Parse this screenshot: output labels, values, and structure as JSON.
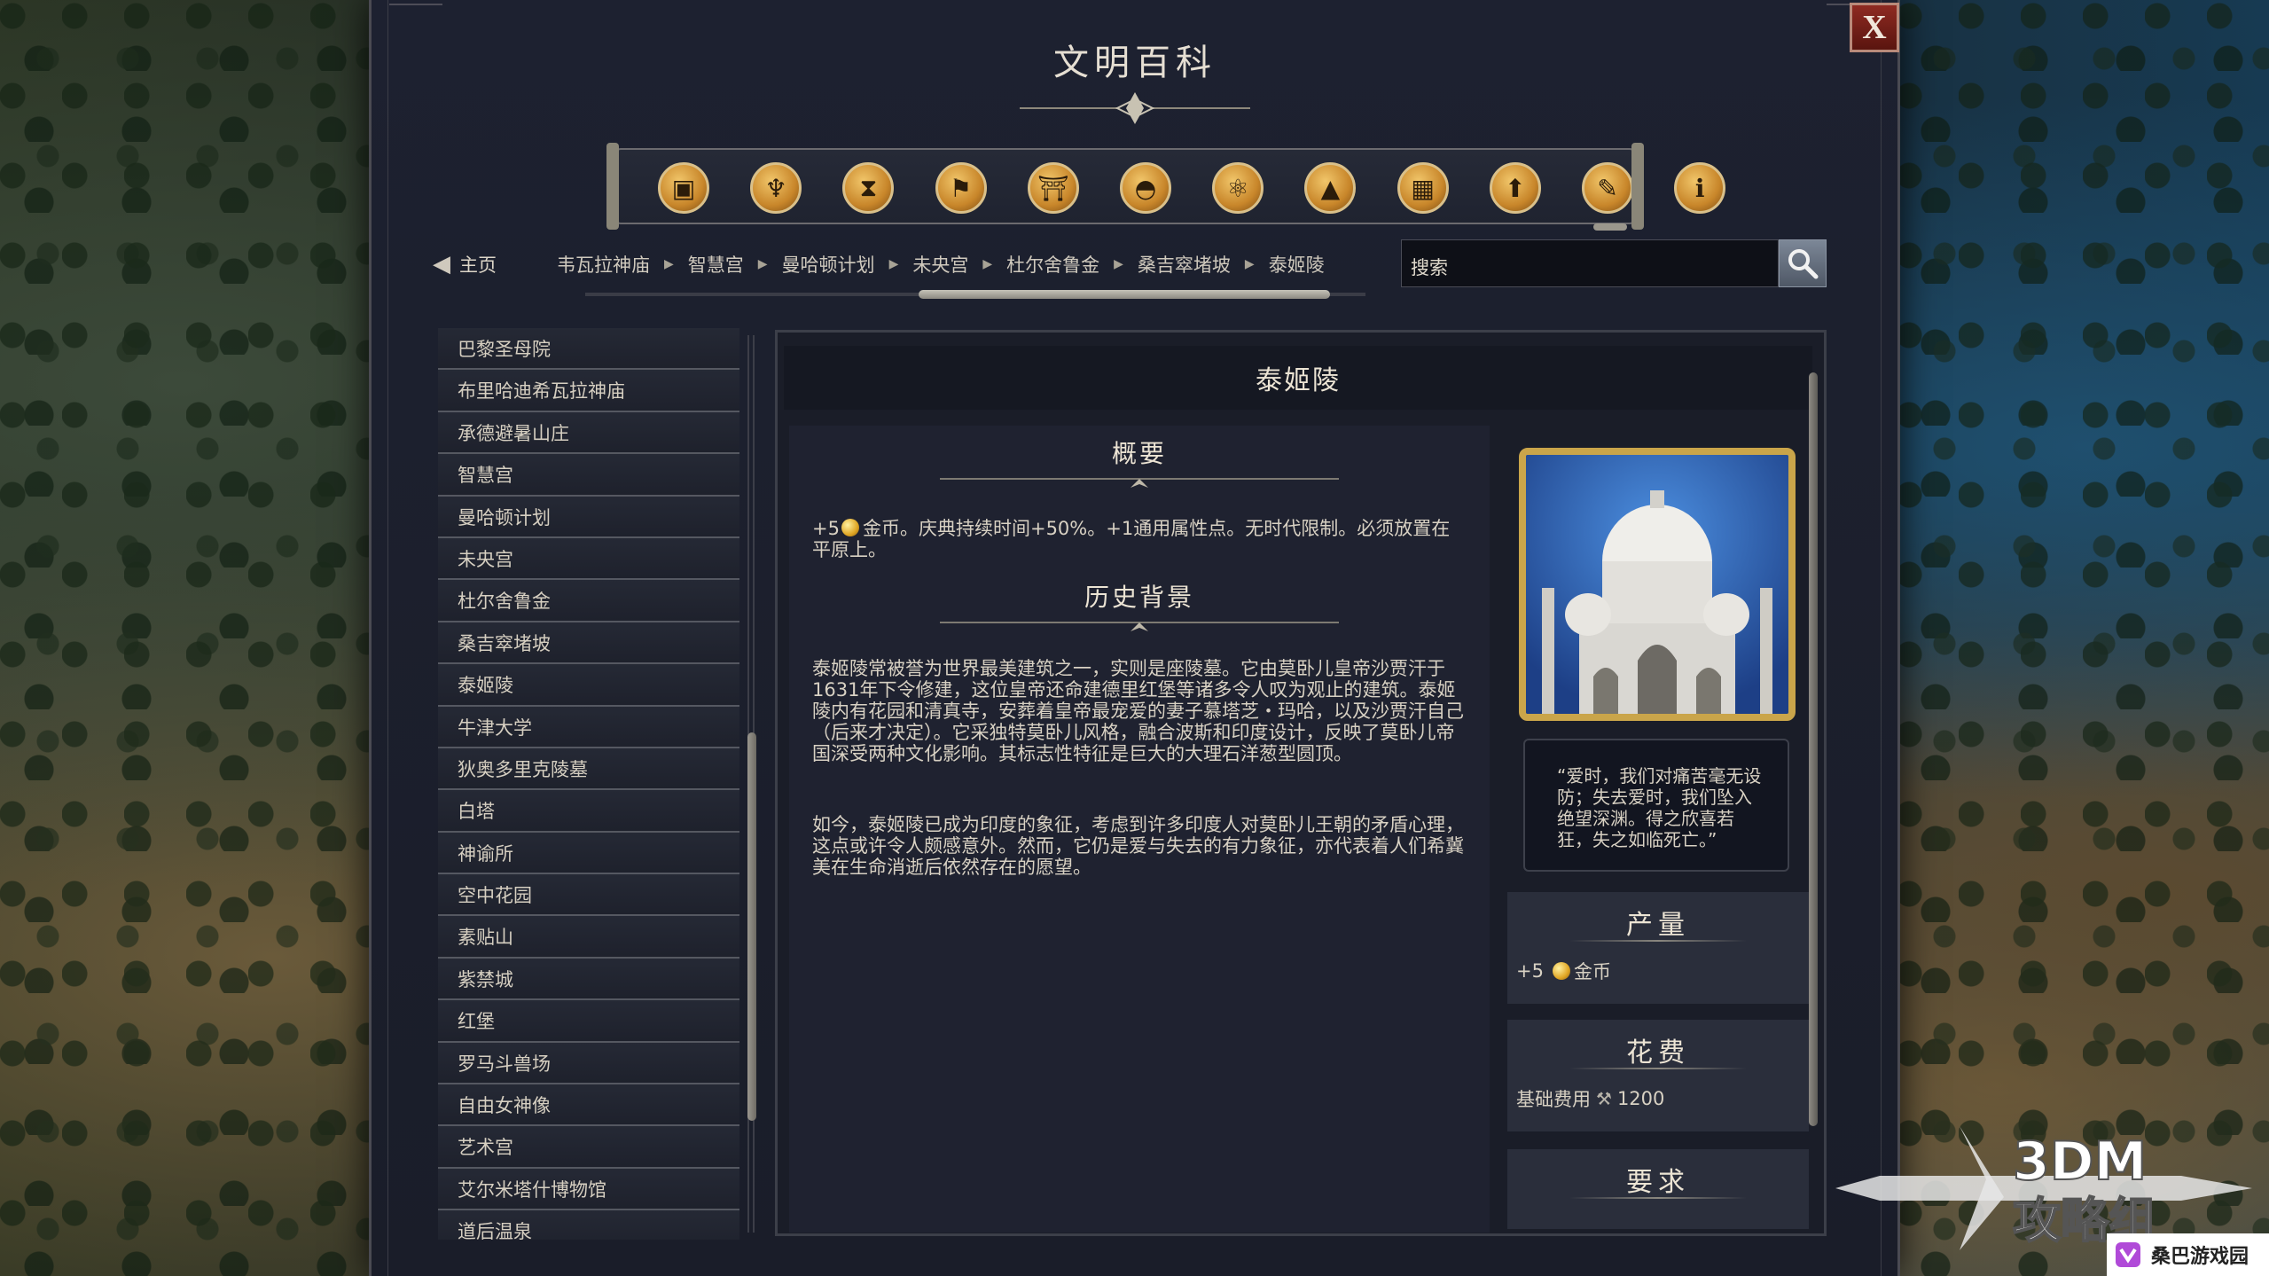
{
  "window": {
    "title": "文明百科",
    "close_label": "X"
  },
  "categories": [
    {
      "icon": "box-icon"
    },
    {
      "icon": "goblet-icon"
    },
    {
      "icon": "hourglass-icon"
    },
    {
      "icon": "flag-icon"
    },
    {
      "icon": "temple-icon"
    },
    {
      "icon": "dome-icon"
    },
    {
      "icon": "atom-icon"
    },
    {
      "icon": "mountain-icon"
    },
    {
      "icon": "city-icon"
    },
    {
      "icon": "up-arrow-icon"
    },
    {
      "icon": "book-icon"
    },
    {
      "icon": "info-icon"
    }
  ],
  "active_category_index": 10,
  "nav": {
    "home_label": "主页",
    "breadcrumbs": [
      "韦瓦拉神庙",
      "智慧宫",
      "曼哈顿计划",
      "未央宫",
      "杜尔舍鲁金",
      "桑吉窣堵坡",
      "泰姬陵"
    ],
    "search_placeholder": "搜索"
  },
  "list_items": [
    "巴黎圣母院",
    "布里哈迪希瓦拉神庙",
    "承德避暑山庄",
    "智慧宫",
    "曼哈顿计划",
    "未央宫",
    "杜尔舍鲁金",
    "桑吉窣堵坡",
    "泰姬陵",
    "牛津大学",
    "狄奥多里克陵墓",
    "白塔",
    "神谕所",
    "空中花园",
    "素贴山",
    "紫禁城",
    "红堡",
    "罗马斗兽场",
    "自由女神像",
    "艺术宫",
    "艾尔米塔什博物馆",
    "道后温泉"
  ],
  "entry": {
    "title": "泰姬陵",
    "overview_title": "概要",
    "overview_prefix": "+5",
    "overview_text": "金币。庆典持续时间+50%。+1通用属性点。无时代限制。必须放置在平原上。",
    "history_title": "历史背景",
    "history_p1": "泰姬陵常被誉为世界最美建筑之一，实则是座陵墓。它由莫卧儿皇帝沙贾汗于1631年下令修建，这位皇帝还命建德里红堡等诸多令人叹为观止的建筑。泰姬陵内有花园和清真寺，安葬着皇帝最宠爱的妻子慕塔芝・玛哈，以及沙贾汗自己（后来才决定）。它采独特莫卧儿风格，融合波斯和印度设计，反映了莫卧儿帝国深受两种文化影响。其标志性特征是巨大的大理石洋葱型圆顶。",
    "history_p2": "如今，泰姬陵已成为印度的象征，考虑到许多印度人对莫卧儿王朝的矛盾心理，这点或许令人颇感意外。然而，它仍是爱与失去的有力象征，亦代表着人们希冀美在生命消逝后依然存在的愿望。",
    "quote": "“爱时，我们对痛苦毫无设防；失去爱时，我们坠入绝望深渊。得之欣喜若狂，失之如临死亡。”",
    "yield_title": "产量",
    "yield_prefix": "+5",
    "yield_label": "金币",
    "cost_title": "花费",
    "cost_label": "基础费用",
    "cost_value": "1200",
    "req_title": "要求"
  },
  "watermarks": {
    "brand_top": "3DM",
    "brand_bottom": "攻略组",
    "site": "桑巴游戏园"
  },
  "colors": {
    "gold": "#e0a624",
    "close_red": "#8e2a22",
    "panel": "#1d2130"
  }
}
